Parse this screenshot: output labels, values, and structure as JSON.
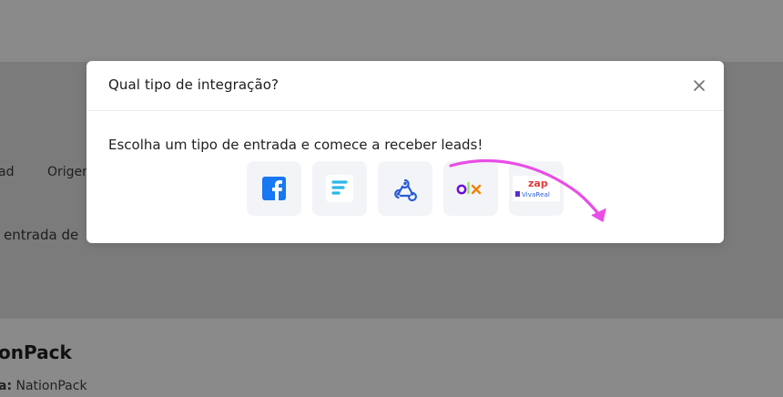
{
  "background": {
    "col1": "ad",
    "col2": "Origen",
    "description": "entrada de",
    "name": "onPack",
    "row_label": "a:",
    "row_value": "NationPack"
  },
  "modal": {
    "title": "Qual tipo de integração?",
    "subtitle": "Escolha um tipo de entrada e comece a receber leads!",
    "options": [
      {
        "name": "facebook",
        "icon": "facebook-icon",
        "color": "#1877f2"
      },
      {
        "name": "form",
        "icon": "form-icon",
        "color": "#2bb7e8"
      },
      {
        "name": "webhook",
        "icon": "webhook-icon",
        "color": "#2a5bd7"
      },
      {
        "name": "olx",
        "icon": "olx-icon",
        "text": "olx"
      },
      {
        "name": "zap-vivareal",
        "icon": "zap-vivareal-icon",
        "text_zap": "zap",
        "text_vivareal": "VivaReal"
      }
    ]
  },
  "colors": {
    "arrow": "#e94de6",
    "overlay": "#7b7b7b"
  }
}
